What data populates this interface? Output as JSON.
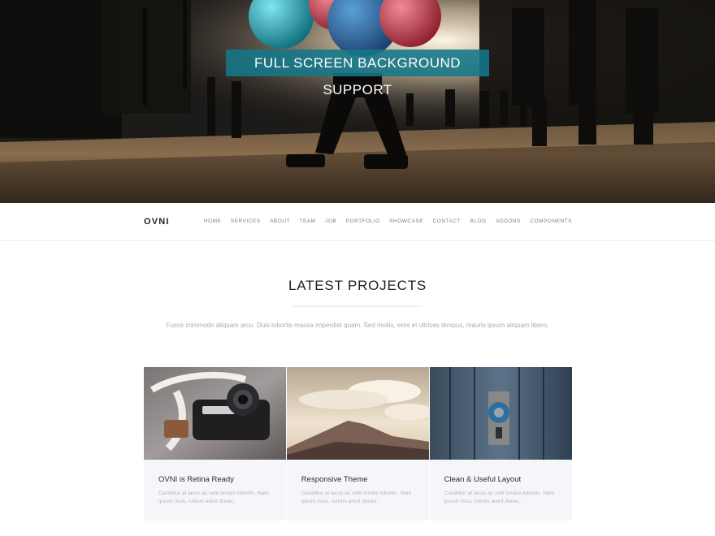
{
  "hero": {
    "title": "FULL SCREEN BACKGROUND SUPPORT"
  },
  "navbar": {
    "brand": "OVNI",
    "links": [
      "HOME",
      "SERVICES",
      "ABOUT",
      "TEAM",
      "JOB",
      "PORTFOLIO",
      "SHOWCASE",
      "CONTACT",
      "BLOG",
      "ADDONS",
      "COMPONENTS"
    ]
  },
  "projects": {
    "title": "LATEST PROJECTS",
    "description": "Fusce commodo aliquam arcu. Duis lobortis massa imperdiet quam. Sed mollis, eros et ultrices tempus, mauris ipsum aliquam libero.",
    "cards": [
      {
        "title": "OVNI is Retina Ready",
        "text": "Curabitur at lacus ac velit ornare lobortis. Nam ipsum risus, rutrum arent donec."
      },
      {
        "title": "Responsive Theme",
        "text": "Curabitur at lacus ac velit ornare lobortis. Nam ipsum risus, rutrum arent donec."
      },
      {
        "title": "Clean & Useful Layout",
        "text": "Curabitur at lacus ac velit ornare lobortis. Nam ipsum risus, rutrum arent donec."
      }
    ]
  },
  "colors": {
    "hero_banner": "#14788a",
    "nav_link": "#7b8089",
    "card_background": "#f5f6f9"
  }
}
